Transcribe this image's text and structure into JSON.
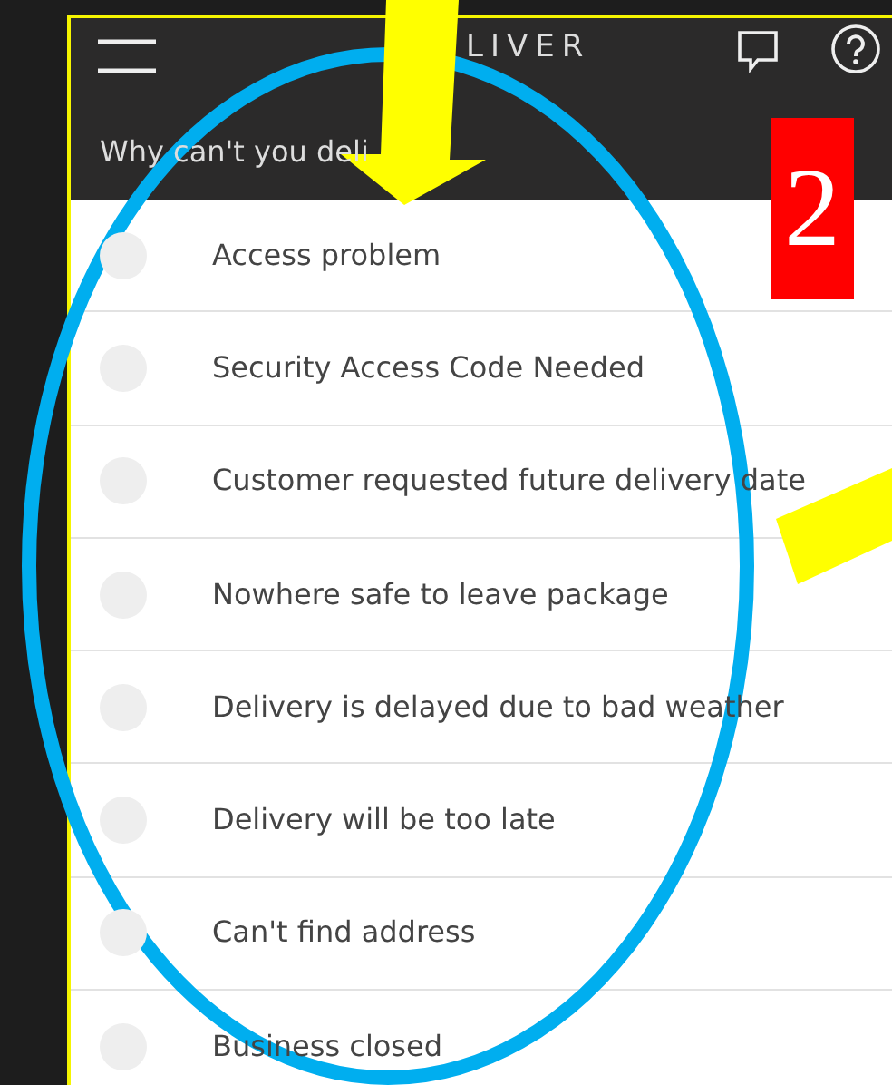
{
  "header": {
    "title": "LIVER",
    "subtitle": "Why can't you deli"
  },
  "reasons": [
    {
      "label": "Access problem",
      "selected": false
    },
    {
      "label": "Security Access Code Needed",
      "selected": false
    },
    {
      "label": "Customer requested future delivery date",
      "selected": false
    },
    {
      "label": "Nowhere safe to leave package",
      "selected": false
    },
    {
      "label": "Delivery is delayed due to bad weather",
      "selected": false
    },
    {
      "label": "Delivery will be too late",
      "selected": false
    },
    {
      "label": "Can't find address",
      "selected": false
    },
    {
      "label": "Business closed",
      "selected": false
    }
  ],
  "annotations": {
    "step_label": "2"
  }
}
